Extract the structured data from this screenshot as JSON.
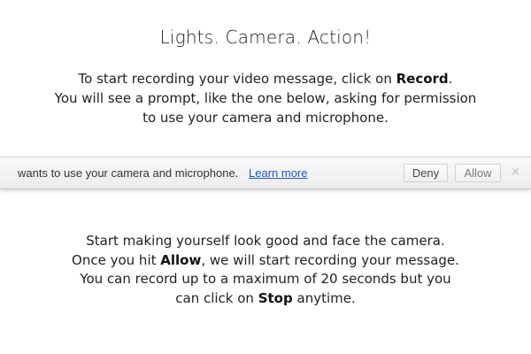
{
  "heading": "Lights. Camera. Action!",
  "intro": {
    "line1_prefix": "To start recording your video message, click on ",
    "line1_bold": "Record",
    "line1_suffix": ".",
    "line2": "You will see a prompt, like the one below, asking for permission",
    "line3": "to use your camera and microphone."
  },
  "permission_bar": {
    "message": "wants to use your camera and microphone.",
    "learn_more": "Learn more",
    "deny_label": "Deny",
    "allow_label": "Allow",
    "close_glyph": "×",
    "colors": {
      "link": "#2255cc",
      "bar_top": "#f9f9f9",
      "bar_bottom": "#ececec"
    }
  },
  "instructions": {
    "line1": "Start making yourself look good and face the camera.",
    "line2_prefix": "Once you hit ",
    "line2_bold": "Allow",
    "line2_suffix": ", we will start recording your message.",
    "line3": "You can record up to a maximum of 20 seconds but you",
    "line4_prefix": "can click on ",
    "line4_bold": "Stop",
    "line4_suffix": " anytime."
  }
}
